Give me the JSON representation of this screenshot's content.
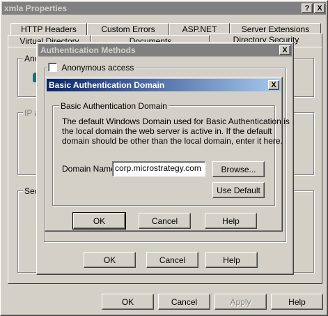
{
  "main_window": {
    "title": "xmla Properties",
    "help_btn": "?",
    "close_btn": "X",
    "tabs_row1": [
      "HTTP Headers",
      "Custom Errors",
      "ASP.NET",
      "Server Extensions"
    ],
    "tabs_row2": [
      "Virtual Directory",
      "Documents",
      "Directory Security"
    ],
    "behind_labels": {
      "anon": "Ano",
      "ip": "IP a",
      "sec": "Sec"
    },
    "buttons": {
      "ok": "OK",
      "cancel": "Cancel",
      "apply": "Apply",
      "help": "Help"
    }
  },
  "auth_dialog": {
    "title": "Authentication Methods",
    "close_btn": "X",
    "anonymous_label": "Anonymous access",
    "anonymous_checked": false,
    "buttons": {
      "ok": "OK",
      "cancel": "Cancel",
      "help": "Help"
    }
  },
  "domain_dialog": {
    "title": "Basic Authentication Domain",
    "close_btn": "X",
    "group_label": "Basic Authentication Domain",
    "description_lines": [
      "The default Windows Domain used for Basic Authentication is",
      "the local domain the web server is active in.  If the default",
      "domain should be other than the local domain, enter it here."
    ],
    "domain_label": "Domain Name:",
    "domain_value": "corp.microstrategy.com",
    "browse_btn": "Browse...",
    "use_default_btn": "Use Default",
    "buttons": {
      "ok": "OK",
      "cancel": "Cancel",
      "help": "Help"
    }
  }
}
